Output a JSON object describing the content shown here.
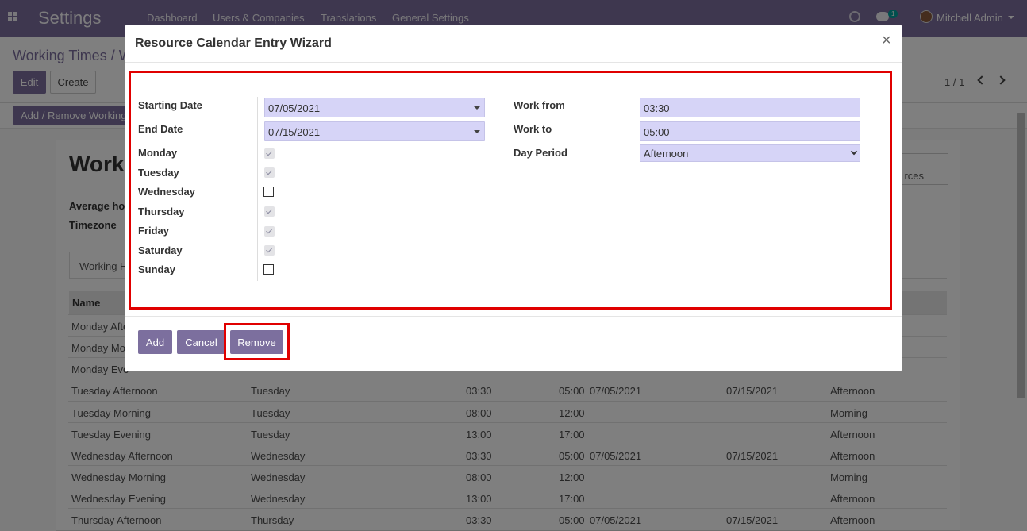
{
  "navbar": {
    "app_title": "Settings",
    "menu": [
      "Dashboard",
      "Users & Companies",
      "Translations",
      "General Settings"
    ],
    "chat_badge": "1",
    "user_name": "Mitchell Admin"
  },
  "control_panel": {
    "breadcrumb": "Working Times / W",
    "edit_label": "Edit",
    "create_label": "Create",
    "pager": "1 / 1",
    "add_remove_label": "Add / Remove Working"
  },
  "sheet": {
    "title": "Worki",
    "average_label": "Average ho",
    "timezone_label": "Timezone",
    "resources_label": "rces",
    "tab_label": "Working H",
    "name_header": "Name",
    "rows": [
      {
        "name": "Monday Afte",
        "day": "",
        "from": "",
        "to": "",
        "start": "",
        "end": "",
        "period": ""
      },
      {
        "name": "Monday Mo",
        "day": "",
        "from": "",
        "to": "",
        "start": "",
        "end": "",
        "period": ""
      },
      {
        "name": "Monday Eve",
        "day": "",
        "from": "",
        "to": "",
        "start": "",
        "end": "",
        "period": ""
      },
      {
        "name": "Tuesday Afternoon",
        "day": "Tuesday",
        "from": "03:30",
        "to": "05:00",
        "start": "07/05/2021",
        "end": "07/15/2021",
        "period": "Afternoon"
      },
      {
        "name": "Tuesday Morning",
        "day": "Tuesday",
        "from": "08:00",
        "to": "12:00",
        "start": "",
        "end": "",
        "period": "Morning"
      },
      {
        "name": "Tuesday Evening",
        "day": "Tuesday",
        "from": "13:00",
        "to": "17:00",
        "start": "",
        "end": "",
        "period": "Afternoon"
      },
      {
        "name": "Wednesday Afternoon",
        "day": "Wednesday",
        "from": "03:30",
        "to": "05:00",
        "start": "07/05/2021",
        "end": "07/15/2021",
        "period": "Afternoon"
      },
      {
        "name": "Wednesday Morning",
        "day": "Wednesday",
        "from": "08:00",
        "to": "12:00",
        "start": "",
        "end": "",
        "period": "Morning"
      },
      {
        "name": "Wednesday Evening",
        "day": "Wednesday",
        "from": "13:00",
        "to": "17:00",
        "start": "",
        "end": "",
        "period": "Afternoon"
      },
      {
        "name": "Thursday Afternoon",
        "day": "Thursday",
        "from": "03:30",
        "to": "05:00",
        "start": "07/05/2021",
        "end": "07/15/2021",
        "period": "Afternoon"
      }
    ]
  },
  "wizard": {
    "title": "Resource Calendar Entry Wizard",
    "close": "×",
    "starting_date_label": "Starting Date",
    "starting_date_value": "07/05/2021",
    "end_date_label": "End Date",
    "end_date_value": "07/15/2021",
    "days": [
      {
        "label": "Monday",
        "checked": true
      },
      {
        "label": "Tuesday",
        "checked": true
      },
      {
        "label": "Wednesday",
        "checked": false
      },
      {
        "label": "Thursday",
        "checked": true
      },
      {
        "label": "Friday",
        "checked": true
      },
      {
        "label": "Saturday",
        "checked": true
      },
      {
        "label": "Sunday",
        "checked": false
      }
    ],
    "work_from_label": "Work from",
    "work_from_value": "03:30",
    "work_to_label": "Work to",
    "work_to_value": "05:00",
    "day_period_label": "Day Period",
    "day_period_value": "Afternoon",
    "add_label": "Add",
    "cancel_label": "Cancel",
    "remove_label": "Remove"
  },
  "colors": {
    "brand": "#7c6f9e",
    "highlight": "#e00000",
    "input_bg": "#d6d4f7"
  }
}
